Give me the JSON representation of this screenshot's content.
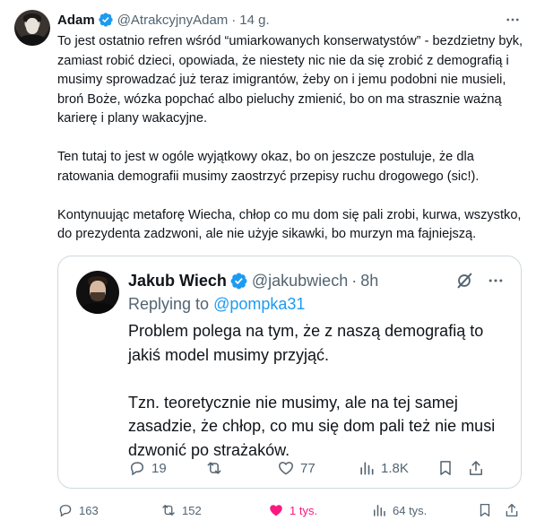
{
  "tweet": {
    "author_name": "Adam",
    "author_handle": "@AtrakcyjnyAdam",
    "separator": "·",
    "time": "14 g.",
    "paragraphs": [
      "To jest ostatnio refren wśród “umiarkowanych konserwatystów” - bezdzietny byk, zamiast robić dzieci, opowiada, że niestety nic nie da się zrobić z demografią i musimy sprowadzać już teraz imigrantów, żeby on i jemu podobni nie musieli, broń Boże, wózka popchać albo pieluchy zmienić, bo on ma strasznie ważną karierę i plany wakacyjne.",
      "Ten tutaj to jest w ogóle wyjątkowy okaz, bo on jeszcze postuluje, że dla ratowania demografii musimy zaostrzyć przepisy ruchu drogowego (sic!).",
      "Kontynuując metaforę Wiecha, chłop co mu dom się pali zrobi, kurwa, wszystko, do prezydenta zadzwoni, ale nie użyje sikawki, bo murzyn ma fajniejszą."
    ],
    "stats": {
      "replies": "163",
      "retweets": "152",
      "likes": "1 tys.",
      "views": "64 tys."
    }
  },
  "quoted": {
    "author_name": "Jakub Wiech",
    "author_handle": "@jakubwiech",
    "separator": "·",
    "time": "8h",
    "replying_prefix": "Replying to ",
    "replying_to": "@pompka31",
    "paragraphs": [
      "Problem polega na tym, że z naszą demografią to jakiś model musimy przyjąć.",
      "Tzn. teoretycznie nie musimy, ale na tej samej zasadzie, że chłop, co mu się dom pali też nie musi dzwonić po strażaków."
    ],
    "stats": {
      "replies": "19",
      "retweets": "",
      "likes": "77",
      "views": "1.8K"
    }
  },
  "colors": {
    "verified": "#1d9bf0",
    "secondary_text": "#536471",
    "like_active": "#f91880",
    "border": "#cfd9de"
  },
  "icons": [
    "verified-badge-icon",
    "more-icon",
    "grok-icon",
    "reply-icon",
    "retweet-icon",
    "like-icon",
    "views-icon",
    "bookmark-icon",
    "share-icon"
  ]
}
